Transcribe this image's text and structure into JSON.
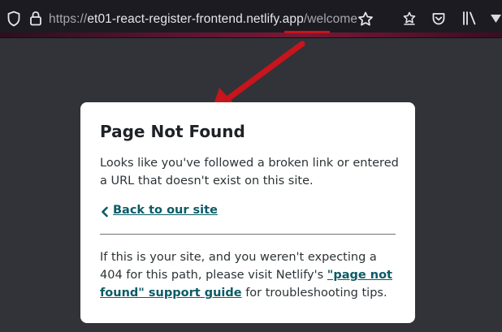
{
  "browser": {
    "url": {
      "scheme": "https://",
      "host": "et01-react-register-frontend.netlify.app",
      "path": "/welcome"
    },
    "icons": [
      "shield-icon",
      "lock-icon",
      "bookmark-star-icon",
      "extensions-icon",
      "pocket-icon",
      "library-icon",
      "menu-chevron-icon"
    ],
    "annotation_color": "#c8141c"
  },
  "error_card": {
    "title": "Page Not Found",
    "message": "Looks like you've followed a broken link or entered a URL that doesn't exist on this site.",
    "back_link": "Back to our site",
    "help_prefix": "If this is your site, and you weren't expecting a 404 for this path, please visit Netlify's ",
    "help_link": "\"page not found\" support guide",
    "help_suffix": " for troubleshooting tips.",
    "link_color": "#0b5b66"
  }
}
